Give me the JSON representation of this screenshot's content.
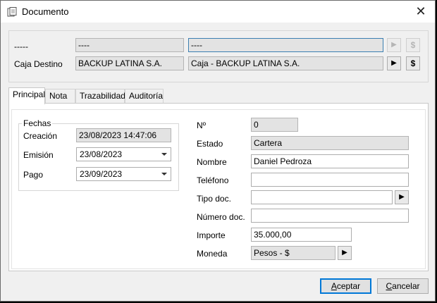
{
  "window": {
    "title": "Documento",
    "close_label": "✕"
  },
  "top": {
    "row1": {
      "label": "-----",
      "field1": "----",
      "field2": "----"
    },
    "row2": {
      "label": "Caja Destino",
      "field1": "BACKUP LATINA S.A.",
      "field2": "Caja - BACKUP LATINA S.A."
    },
    "arrow_glyph": "▶",
    "dollar_glyph": "$"
  },
  "tabs": [
    {
      "label": "Principal",
      "active": true
    },
    {
      "label": "Nota",
      "active": false
    },
    {
      "label": "Trazabilidad",
      "active": false
    },
    {
      "label": "Auditoría",
      "active": false
    }
  ],
  "fechas": {
    "legend": "Fechas",
    "creacion": {
      "label": "Creación",
      "value": "23/08/2023 14:47:06"
    },
    "emision": {
      "label": "Emisión",
      "value": "23/08/2023"
    },
    "pago": {
      "label": "Pago",
      "value": "23/09/2023"
    }
  },
  "form": {
    "numero": {
      "label": "Nº",
      "value": "0"
    },
    "estado": {
      "label": "Estado",
      "value": "Cartera"
    },
    "nombre": {
      "label": "Nombre",
      "value": "Daniel Pedroza"
    },
    "telefono": {
      "label": "Teléfono",
      "value": ""
    },
    "tipo_doc": {
      "label": "Tipo doc.",
      "value": ""
    },
    "numero_doc": {
      "label": "Número doc.",
      "value": ""
    },
    "importe": {
      "label": "Importe",
      "value": "35.000,00"
    },
    "moneda": {
      "label": "Moneda",
      "value": "Pesos - $"
    }
  },
  "buttons": {
    "accept_prefix": "A",
    "accept_rest": "ceptar",
    "cancel_prefix": "C",
    "cancel_rest": "ancelar"
  }
}
